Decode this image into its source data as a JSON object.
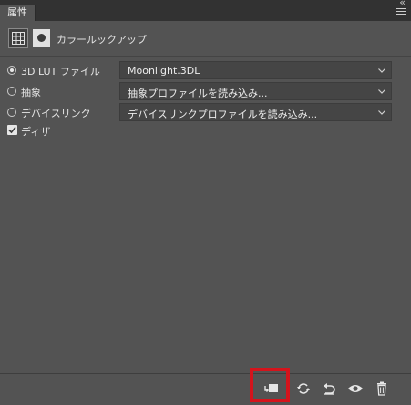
{
  "panel": {
    "tab_label": "属性",
    "collapse_glyph": "«",
    "menu_icon": "panel-menu-icon"
  },
  "header": {
    "title": "カラールックアップ",
    "icons": [
      "adjustment-grid-icon",
      "layer-mask-icon"
    ]
  },
  "options": [
    {
      "label": "3D LUT ファイル",
      "selected": true,
      "select_value": "Moonlight.3DL"
    },
    {
      "label": "抽象",
      "selected": false,
      "select_value": "抽象プロファイルを読み込み..."
    },
    {
      "label": "デバイスリンク",
      "selected": false,
      "select_value": "デバイスリンクプロファイルを読み込み..."
    }
  ],
  "dither": {
    "label": "ディザ",
    "checked": true
  },
  "toolbar": {
    "buttons": [
      "clip-to-layer-icon",
      "view-previous-state-icon",
      "reset-icon",
      "visibility-icon",
      "trash-icon"
    ],
    "highlighted": "clip-to-layer-icon",
    "highlight_color": "#d4141c"
  },
  "colors": {
    "panel_bg": "#535353",
    "tabbar_bg": "#323232",
    "field_bg": "#454545"
  }
}
